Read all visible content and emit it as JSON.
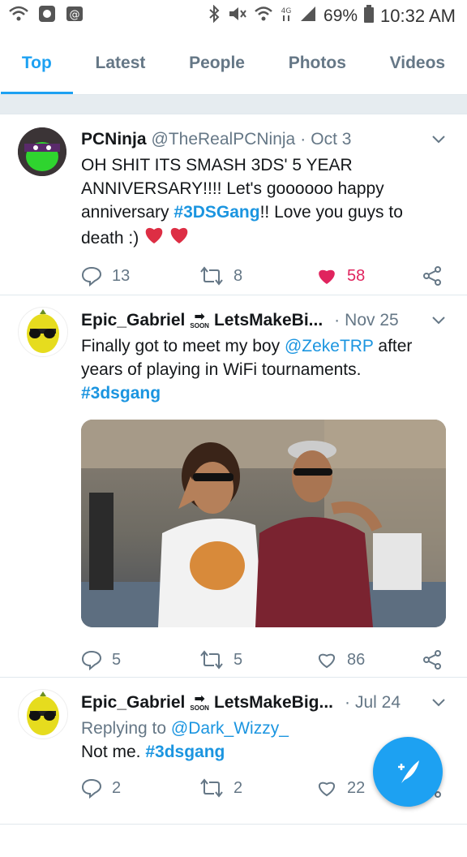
{
  "status_bar": {
    "battery": "69%",
    "time": "10:32 AM"
  },
  "tabs": [
    {
      "label": "Top",
      "active": true
    },
    {
      "label": "Latest"
    },
    {
      "label": "People"
    },
    {
      "label": "Photos"
    },
    {
      "label": "Videos"
    }
  ],
  "tweets": [
    {
      "name": "PCNinja",
      "handle": "@TheRealPCNinja",
      "date": "Oct 3",
      "text_line1": "OH SHIT ITS SMASH 3DS' 5 YEAR",
      "text_line2": "ANNIVERSARY!!!! Let's goooooo happy",
      "text_line3_pre": "anniversary ",
      "hashtag": "#3DSGang",
      "text_line3_post": "!! Love you guys to",
      "text_line4": "death :)",
      "replies": "13",
      "retweets": "8",
      "likes": "58"
    },
    {
      "name": "Epic_Gabriel",
      "name_suffix": "LetsMakeBi...",
      "soon_label": "SOON",
      "date": "Nov 25",
      "text_line1_pre": "Finally got to meet my boy ",
      "mention": "@ZekeTRP",
      "text_line1_post": " after",
      "text_line2": "years of playing in WiFi tournaments.",
      "hashtag": "#3dsgang",
      "replies": "5",
      "retweets": "5",
      "likes": "86"
    },
    {
      "name": "Epic_Gabriel",
      "name_suffix": "LetsMakeBig...",
      "soon_label": "SOON",
      "date": "Jul 24",
      "replying_prefix": "Replying to ",
      "replying_to": "@Dark_Wizzy_",
      "text_pre": "Not me. ",
      "hashtag": "#3dsgang",
      "replies": "2",
      "retweets": "2",
      "likes": "22"
    }
  ],
  "colors": {
    "accent": "#1da1f2",
    "like_active": "#e0245e",
    "muted": "#657786"
  }
}
